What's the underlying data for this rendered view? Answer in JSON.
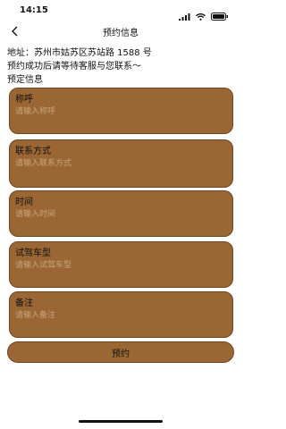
{
  "status": {
    "time": "14:15"
  },
  "nav": {
    "title": "预约信息"
  },
  "info": {
    "address": "地址：苏州市姑苏区苏站路 1588 号",
    "notice": "预约成功后请等待客服与您联系～",
    "section": "预定信息"
  },
  "form": {
    "fields": [
      {
        "label": "称呼",
        "placeholder": "请输入称呼"
      },
      {
        "label": "联系方式",
        "placeholder": "请输入联系方式"
      },
      {
        "label": "时间",
        "placeholder": "请输入时间"
      },
      {
        "label": "试驾车型",
        "placeholder": "请输入试驾车型"
      },
      {
        "label": "备注",
        "placeholder": "请输入备注"
      }
    ],
    "submit_label": "预约"
  },
  "colors": {
    "card": "#9a6734",
    "border": "#6e4622",
    "placeholder": "#c9a67e"
  }
}
